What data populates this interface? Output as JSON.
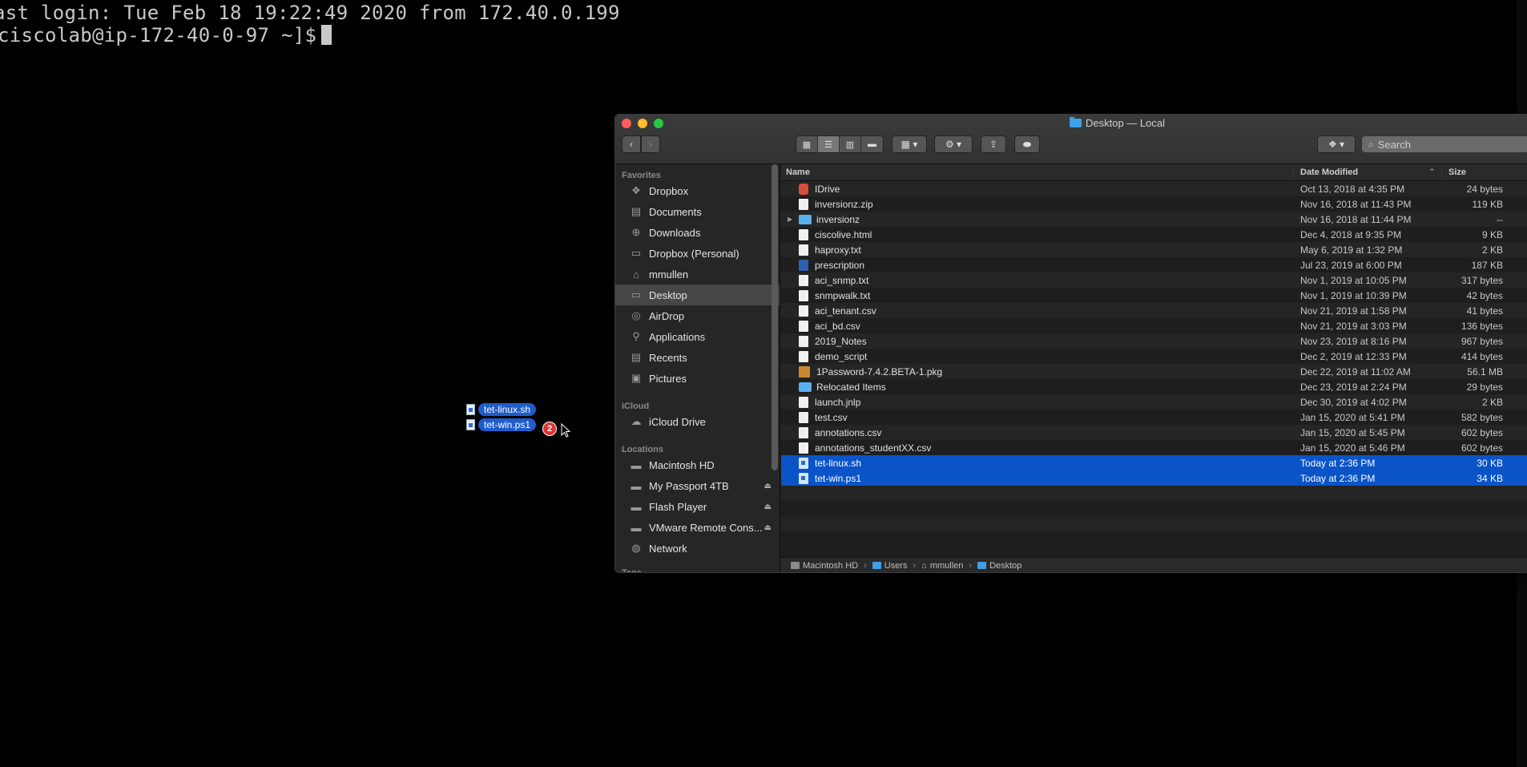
{
  "terminal": {
    "line1": "ast login: Tue Feb 18 19:22:49 2020 from 172.40.0.199",
    "line2": "ciscolab@ip-172-40-0-97 ~]$"
  },
  "drag": {
    "items": [
      "tet-linux.sh",
      "tet-win.ps1"
    ],
    "count": "2"
  },
  "finder": {
    "title": "Desktop — Local",
    "search_placeholder": "Search",
    "sidebar": {
      "favorites_heading": "Favorites",
      "favorites": [
        {
          "label": "Dropbox",
          "icon": "dropbox-icon"
        },
        {
          "label": "Documents",
          "icon": "documents-icon"
        },
        {
          "label": "Downloads",
          "icon": "downloads-icon"
        },
        {
          "label": "Dropbox (Personal)",
          "icon": "folder-icon"
        },
        {
          "label": "mmullen",
          "icon": "home-icon"
        },
        {
          "label": "Desktop",
          "icon": "desktop-icon"
        },
        {
          "label": "AirDrop",
          "icon": "airdrop-icon"
        },
        {
          "label": "Applications",
          "icon": "applications-icon"
        },
        {
          "label": "Recents",
          "icon": "recents-icon"
        },
        {
          "label": "Pictures",
          "icon": "pictures-icon"
        }
      ],
      "icloud_heading": "iCloud",
      "icloud": [
        {
          "label": "iCloud Drive",
          "icon": "cloud-icon"
        }
      ],
      "locations_heading": "Locations",
      "locations": [
        {
          "label": "Macintosh HD",
          "icon": "disk-icon"
        },
        {
          "label": "My Passport 4TB",
          "icon": "disk-icon"
        },
        {
          "label": "Flash Player",
          "icon": "disk-icon"
        },
        {
          "label": "VMware Remote Cons...",
          "icon": "disk-icon"
        },
        {
          "label": "Network",
          "icon": "network-icon"
        }
      ],
      "tags_heading": "Tags"
    },
    "columns": {
      "name": "Name",
      "date": "Date Modified",
      "size": "Size"
    },
    "files": [
      {
        "name": "IDrive",
        "date": "Oct 13, 2018 at 4:35 PM",
        "size": "24 bytes",
        "kind": "app"
      },
      {
        "name": "inversionz.zip",
        "date": "Nov 16, 2018 at 11:43 PM",
        "size": "119 KB",
        "kind": "doc"
      },
      {
        "name": "inversionz",
        "date": "Nov 16, 2018 at 11:44 PM",
        "size": "--",
        "kind": "folder"
      },
      {
        "name": "ciscolive.html",
        "date": "Dec 4, 2018 at 9:35 PM",
        "size": "9 KB",
        "kind": "doc"
      },
      {
        "name": "haproxy.txt",
        "date": "May 6, 2019 at 1:32 PM",
        "size": "2 KB",
        "kind": "doc"
      },
      {
        "name": "prescription",
        "date": "Jul 23, 2019 at 6:00 PM",
        "size": "187 KB",
        "kind": "word"
      },
      {
        "name": "aci_snmp.txt",
        "date": "Nov 1, 2019 at 10:05 PM",
        "size": "317 bytes",
        "kind": "doc"
      },
      {
        "name": "snmpwalk.txt",
        "date": "Nov 1, 2019 at 10:39 PM",
        "size": "42 bytes",
        "kind": "doc"
      },
      {
        "name": "aci_tenant.csv",
        "date": "Nov 21, 2019 at 1:58 PM",
        "size": "41 bytes",
        "kind": "doc"
      },
      {
        "name": "aci_bd.csv",
        "date": "Nov 21, 2019 at 3:03 PM",
        "size": "136 bytes",
        "kind": "doc"
      },
      {
        "name": "2019_Notes",
        "date": "Nov 23, 2019 at 8:16 PM",
        "size": "967 bytes",
        "kind": "doc"
      },
      {
        "name": "demo_script",
        "date": "Dec 2, 2019 at 12:33 PM",
        "size": "414 bytes",
        "kind": "doc"
      },
      {
        "name": "1Password-7.4.2.BETA-1.pkg",
        "date": "Dec 22, 2019 at 11:02 AM",
        "size": "56.1 MB",
        "kind": "pkg"
      },
      {
        "name": "Relocated Items",
        "date": "Dec 23, 2019 at 2:24 PM",
        "size": "29 bytes",
        "kind": "folder"
      },
      {
        "name": "launch.jnlp",
        "date": "Dec 30, 2019 at 4:02 PM",
        "size": "2 KB",
        "kind": "doc"
      },
      {
        "name": "test.csv",
        "date": "Jan 15, 2020 at 5:41 PM",
        "size": "582 bytes",
        "kind": "doc"
      },
      {
        "name": "annotations.csv",
        "date": "Jan 15, 2020 at 5:45 PM",
        "size": "602 bytes",
        "kind": "doc"
      },
      {
        "name": "annotations_studentXX.csv",
        "date": "Jan 15, 2020 at 5:46 PM",
        "size": "602 bytes",
        "kind": "doc"
      },
      {
        "name": "tet-linux.sh",
        "date": "Today at 2:36 PM",
        "size": "30 KB",
        "kind": "script",
        "selected": true
      },
      {
        "name": "tet-win.ps1",
        "date": "Today at 2:36 PM",
        "size": "34 KB",
        "kind": "script",
        "selected": true
      }
    ],
    "pathbar": [
      "Macintosh HD",
      "Users",
      "mmullen",
      "Desktop"
    ]
  }
}
